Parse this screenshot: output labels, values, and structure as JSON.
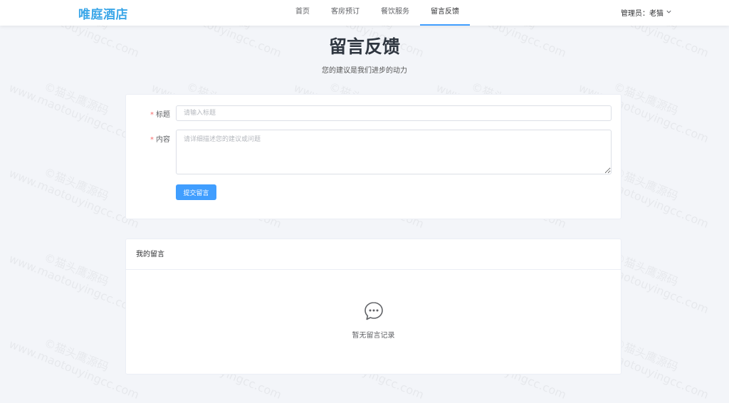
{
  "header": {
    "logo": "唯庭酒店",
    "nav": [
      "首页",
      "客房预订",
      "餐饮服务",
      "留言反馈"
    ],
    "active_nav": "留言反馈",
    "admin": "管理员：老猫"
  },
  "page": {
    "title": "留言反馈",
    "subtitle": "您的建议是我们进步的动力"
  },
  "form": {
    "title_label": "标题",
    "title_placeholder": "请输入标题",
    "title_value": "",
    "content_label": "内容",
    "content_placeholder": "请详细描述您的建议或问题",
    "content_value": "",
    "submit_label": "提交留言"
  },
  "messages": {
    "header": "我的留言",
    "empty_text": "暂无留言记录",
    "items": []
  },
  "watermark": {
    "line1": "©猫头鹰源码",
    "line2": "www.maotouyingcc.com"
  },
  "colors": {
    "brand": "#3aa6e8",
    "primary": "#409eff",
    "required": "#f56c6c",
    "background": "#f3f5f9"
  },
  "icons": [
    "chevron-down-icon",
    "chat-bubble-icon"
  ]
}
